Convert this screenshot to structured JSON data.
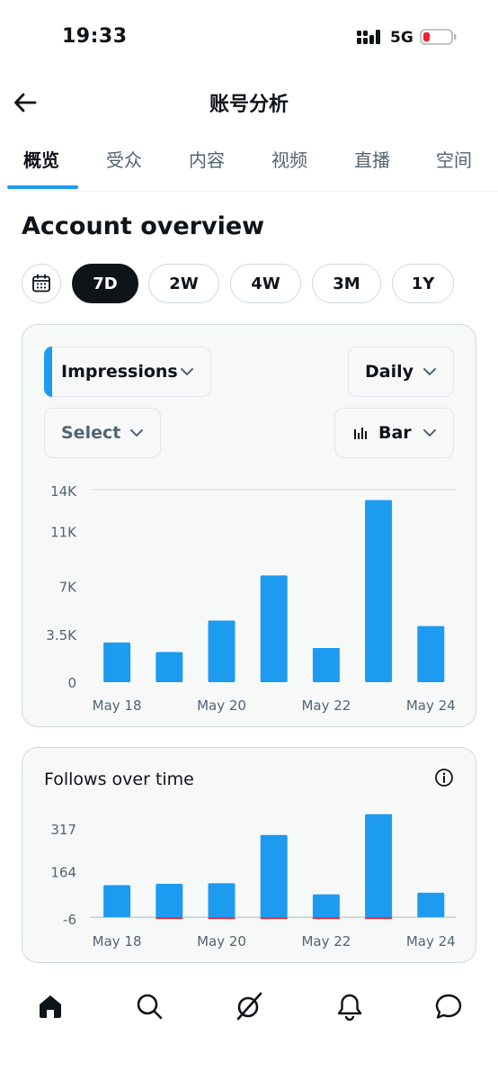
{
  "status_bar": {
    "time": "19:33",
    "network": "5G"
  },
  "header": {
    "title": "账号分析"
  },
  "tabs": [
    {
      "label": "概览"
    },
    {
      "label": "受众"
    },
    {
      "label": "内容"
    },
    {
      "label": "视频"
    },
    {
      "label": "直播"
    },
    {
      "label": "空间"
    }
  ],
  "section_title": "Account overview",
  "ranges": [
    "7D",
    "2W",
    "4W",
    "3M",
    "1Y"
  ],
  "selected_range": "7D",
  "controls": {
    "metric": "Impressions",
    "interval": "Daily",
    "compare": "Select",
    "chart_type": "Bar"
  },
  "colors": {
    "accent": "#1d9bf0",
    "negative": "#f4212e",
    "text": "#0f1419",
    "muted": "#536471"
  },
  "follows_card": {
    "title": "Follows over time"
  },
  "chart_data": [
    {
      "type": "bar",
      "title": "",
      "categories": [
        "May 18",
        "May 19",
        "May 20",
        "May 21",
        "May 22",
        "May 23",
        "May 24"
      ],
      "x_tick_labels": [
        "May 18",
        "May 20",
        "May 22",
        "May 24"
      ],
      "values": [
        2900,
        2200,
        4500,
        7800,
        2500,
        13300,
        4100
      ],
      "y_ticks": [
        "0",
        "3.5K",
        "7K",
        "11K",
        "14K"
      ],
      "ylim": [
        0,
        14000
      ],
      "xlabel": "",
      "ylabel": "",
      "grid": false
    },
    {
      "type": "bar",
      "title": "Follows over time",
      "categories": [
        "May 18",
        "May 19",
        "May 20",
        "May 21",
        "May 22",
        "May 23",
        "May 24"
      ],
      "x_tick_labels": [
        "May 18",
        "May 20",
        "May 22",
        "May 24"
      ],
      "series": [
        {
          "values": [
            115,
            120,
            122,
            295,
            82,
            370,
            88
          ]
        },
        {
          "values": [
            0,
            -4,
            -4,
            -3,
            -4,
            -5,
            0
          ]
        }
      ],
      "y_ticks": [
        "-6",
        "164",
        "317"
      ],
      "ylim": [
        -6,
        317
      ],
      "xlabel": "",
      "ylabel": "",
      "grid": false
    }
  ]
}
